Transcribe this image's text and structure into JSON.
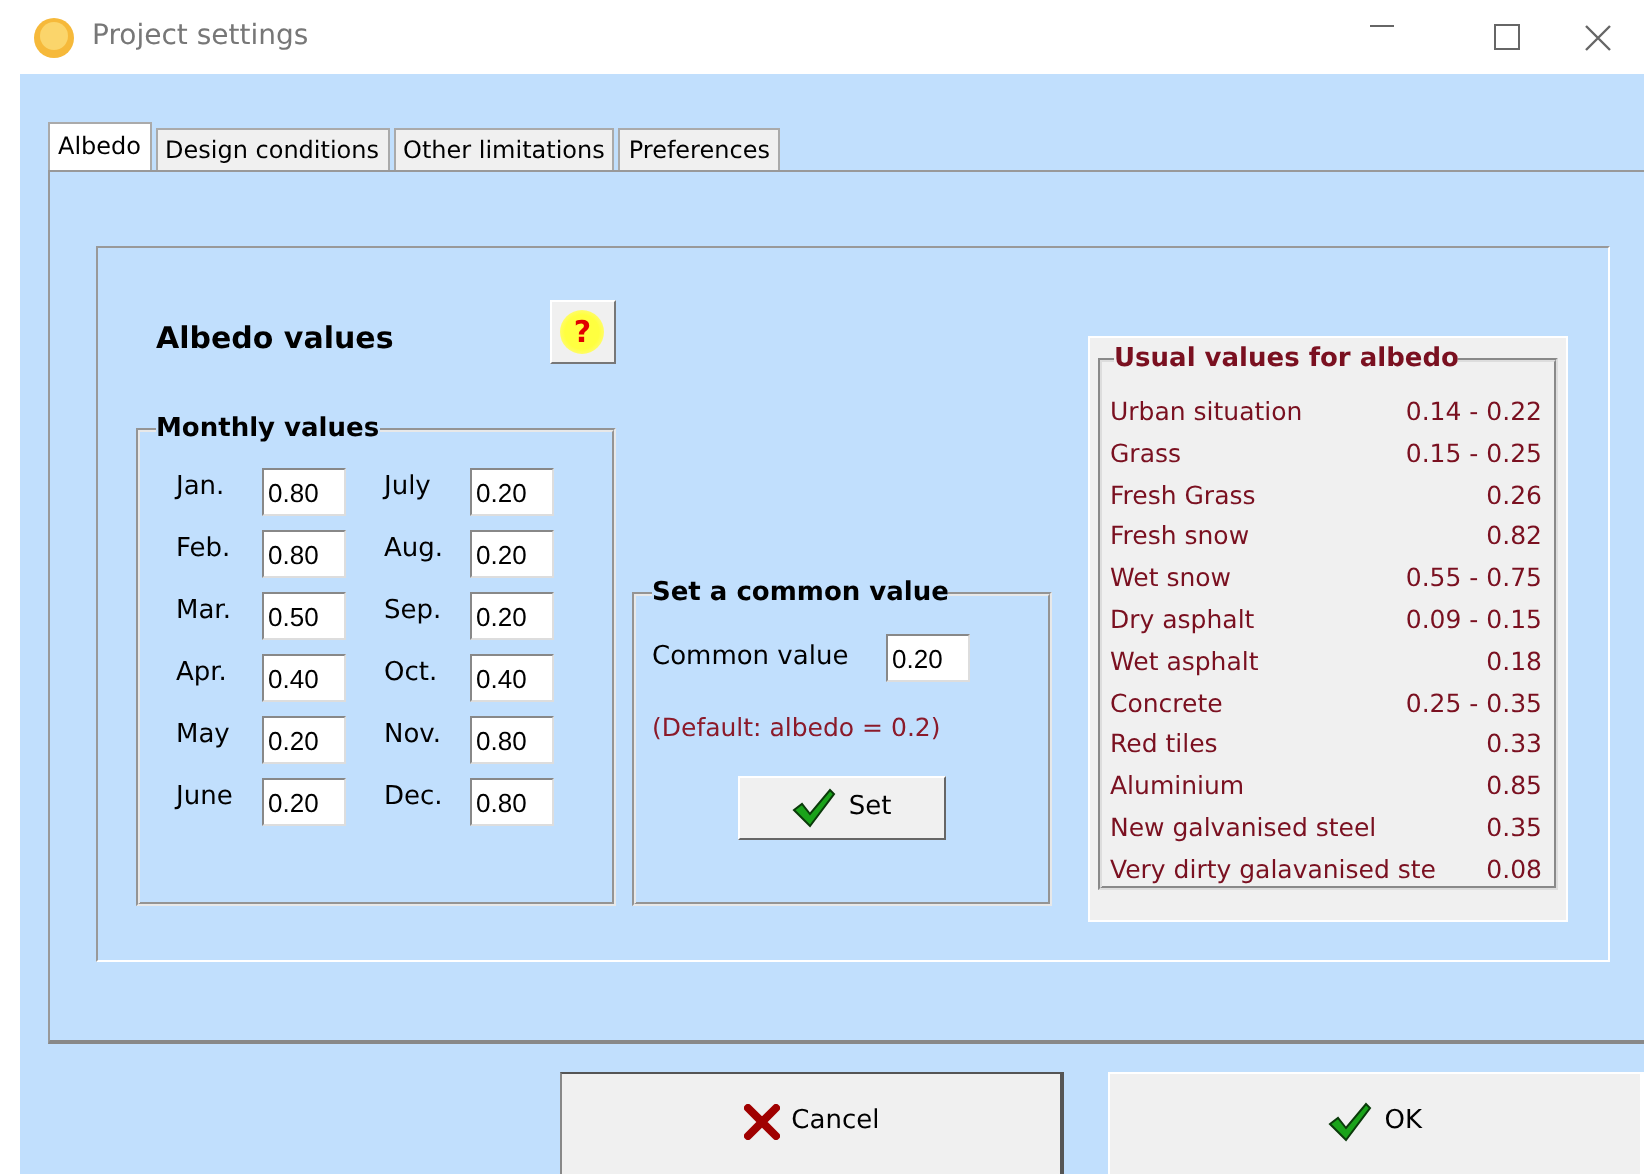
{
  "window": {
    "title": "Project settings"
  },
  "tabs": [
    {
      "label": "Albedo",
      "selected": true
    },
    {
      "label": "Design conditions",
      "selected": false
    },
    {
      "label": "Other limitations",
      "selected": false
    },
    {
      "label": "Preferences",
      "selected": false
    }
  ],
  "heading": "Albedo values",
  "help_button": "?",
  "monthly": {
    "title": "Monthly values",
    "months": [
      {
        "label": "Jan.",
        "value": "0.80"
      },
      {
        "label": "Feb.",
        "value": "0.80"
      },
      {
        "label": "Mar.",
        "value": "0.50"
      },
      {
        "label": "Apr.",
        "value": "0.40"
      },
      {
        "label": "May",
        "value": "0.20"
      },
      {
        "label": "June",
        "value": "0.20"
      },
      {
        "label": "July",
        "value": "0.20"
      },
      {
        "label": "Aug.",
        "value": "0.20"
      },
      {
        "label": "Sep.",
        "value": "0.20"
      },
      {
        "label": "Oct.",
        "value": "0.40"
      },
      {
        "label": "Nov.",
        "value": "0.80"
      },
      {
        "label": "Dec.",
        "value": "0.80"
      }
    ]
  },
  "common": {
    "title": "Set a common value",
    "label": "Common value",
    "value": "0.20",
    "note": "(Default: albedo = 0.2)",
    "button": "Set"
  },
  "usual": {
    "title": "Usual values for albedo",
    "rows": [
      {
        "name": "Urban situation",
        "value": "0.14 - 0.22"
      },
      {
        "name": "Grass",
        "value": "0.15 - 0.25"
      },
      {
        "name": "Fresh Grass",
        "value": "0.26"
      },
      {
        "name": "Fresh snow",
        "value": "0.82"
      },
      {
        "name": "Wet snow",
        "value": "0.55 - 0.75"
      },
      {
        "name": "Dry asphalt",
        "value": "0.09 - 0.15"
      },
      {
        "name": "Wet asphalt",
        "value": "0.18"
      },
      {
        "name": "Concrete",
        "value": "0.25 - 0.35"
      },
      {
        "name": "Red tiles",
        "value": "0.33"
      },
      {
        "name": "Aluminium",
        "value": "0.85"
      },
      {
        "name": "New galvanised steel",
        "value": "0.35"
      },
      {
        "name": "Very dirty galavanised ste",
        "value": "0.08"
      }
    ]
  },
  "buttons": [
    {
      "label": "Cancel",
      "kind": "cancel"
    },
    {
      "label": "OK",
      "kind": "ok"
    }
  ]
}
